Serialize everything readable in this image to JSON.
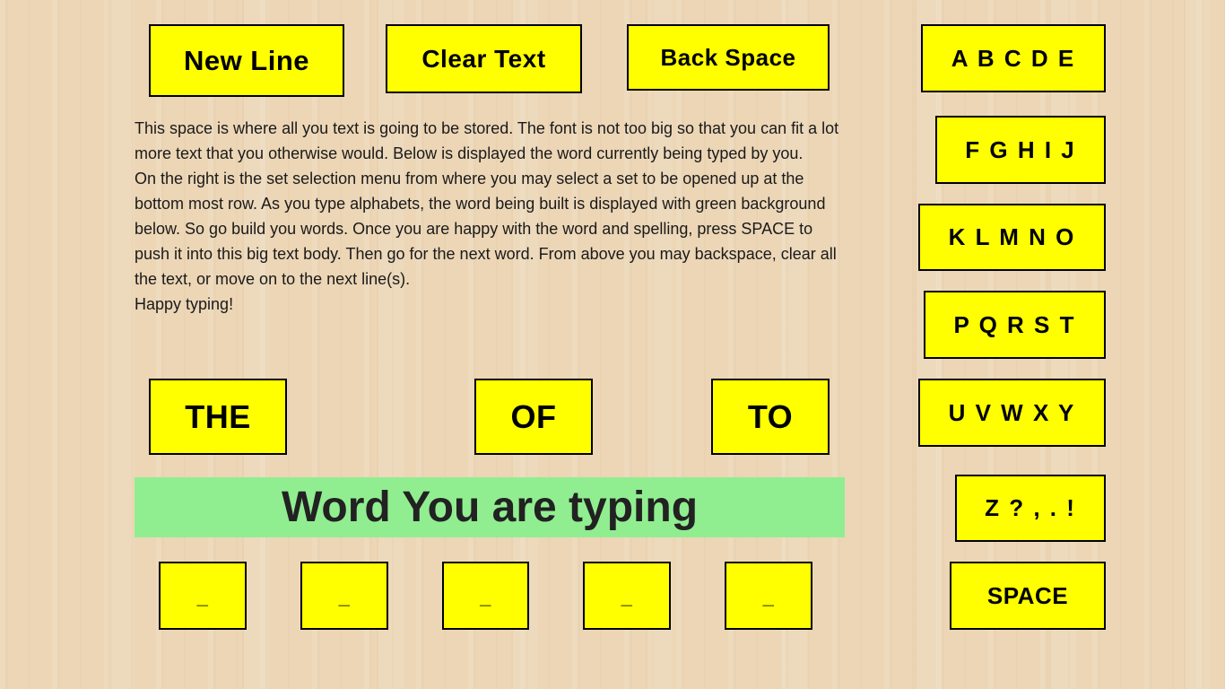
{
  "toolbar": {
    "new_line": "New Line",
    "clear_text": "Clear Text",
    "back_space": "Back Space"
  },
  "text_body": {
    "paragraphs": [
      "This space is where all you text is going to be stored. The font is not too big so that you can fit a lot more text that you otherwise would. Below is displayed the word currently being typed by you.",
      "On the right is the set selection menu from where you may select a set to be opened up at the bottom most row. As you type alphabets, the word being built is displayed with green background below. So go build you words. Once you are happy with the word and spelling, press SPACE to push it into this big text body. Then go for the next word. From above you may backspace, clear all the text, or move on to the next line(s).",
      "Happy typing!"
    ]
  },
  "suggestions": [
    "THE",
    "OF",
    "TO"
  ],
  "current_word": "Word You are typing",
  "letter_slots": [
    "_",
    "_",
    "_",
    "_",
    "_"
  ],
  "sets": [
    "A B C D E",
    "F G H I J",
    "K L M N O",
    "P Q R S T",
    "U V W X Y",
    "Z ? , . !"
  ],
  "space_label": "SPACE",
  "colors": {
    "button_bg": "#ffff00",
    "word_bg": "#90ee90"
  }
}
